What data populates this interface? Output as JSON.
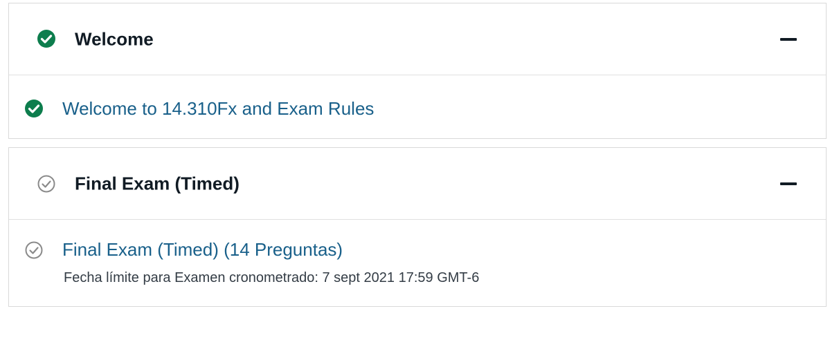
{
  "sections": [
    {
      "title": "Welcome",
      "status_icon": "check-circle-filled-icon",
      "collapse_icon": "minus-icon",
      "units": [
        {
          "title": "Welcome to 14.310Fx and Exam Rules",
          "status_icon": "check-circle-filled-icon"
        }
      ]
    },
    {
      "title": "Final Exam (Timed)",
      "status_icon": "check-circle-outline-icon",
      "collapse_icon": "minus-icon",
      "units": [
        {
          "title": "Final Exam (Timed) (14 Preguntas)",
          "due_text": "Fecha límite para Examen cronometrado: 7 sept 2021 17:59 GMT-6",
          "status_icon": "check-circle-outline-icon"
        }
      ]
    }
  ],
  "colors": {
    "complete_green": "#0d7d4d",
    "incomplete_gray": "#8a8a8a",
    "link_blue": "#19608a",
    "title_dark": "#111b24",
    "border": "#d9d9d9"
  }
}
